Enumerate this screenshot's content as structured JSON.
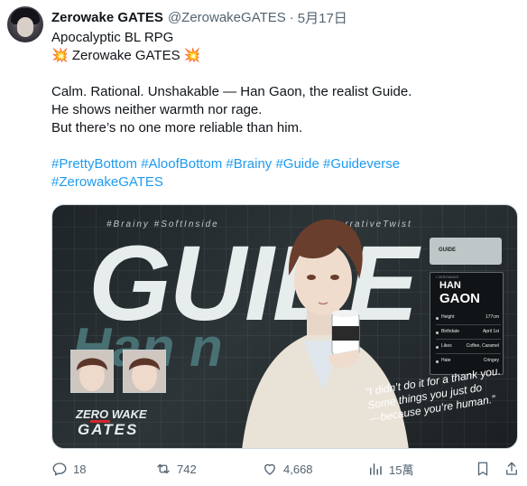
{
  "tweet": {
    "display_name": "Zerowake GATES",
    "handle": "@ZerowakeGATES",
    "separator": "·",
    "date": "5月17日",
    "lines": [
      "Apocalyptic BL RPG",
      "💥 Zerowake GATES 💥",
      "",
      "Calm. Rational. Unshakable — Han Gaon, the realist Guide.",
      "He shows neither warmth nor rage.",
      "But there’s no one more reliable than him."
    ],
    "hashtags_line1": "#PrettyBottom #AloofBottom #Brainy #Guide #Guideverse",
    "hashtags_line2": "#ZerowakeGATES"
  },
  "media": {
    "tagline_left": "#Brainy #SoftInside",
    "tagline_right": "#NarrativeTwist",
    "headline": "GUIDE",
    "subheadline": "Han      n",
    "card": {
      "folder_label": "GUIDE",
      "small_label": "▪ ZEROWAKE",
      "first_name": "HAN",
      "last_name": "GAON",
      "rows": [
        {
          "key": "Height",
          "value": "177cm"
        },
        {
          "key": "Birthdate",
          "value": "April 1st"
        },
        {
          "key": "Likes",
          "value": "Coffee, Caramel"
        },
        {
          "key": "Hate",
          "value": "Cringey"
        }
      ]
    },
    "logo_line1": "ZERO WAKE",
    "logo_line2": "GATES",
    "quote_lines": [
      "“I didn’t do it for a thank you.",
      "Some things you just do",
      "—because you’re human.”"
    ]
  },
  "actions": {
    "replies": "18",
    "retweets": "742",
    "likes": "4,668",
    "views": "15萬"
  },
  "colors": {
    "link": "#1d9bf0",
    "text": "#0f1419",
    "secondary": "#536471"
  },
  "icons": [
    "reply-icon",
    "retweet-icon",
    "like-icon",
    "views-icon",
    "bookmark-icon",
    "share-icon"
  ]
}
